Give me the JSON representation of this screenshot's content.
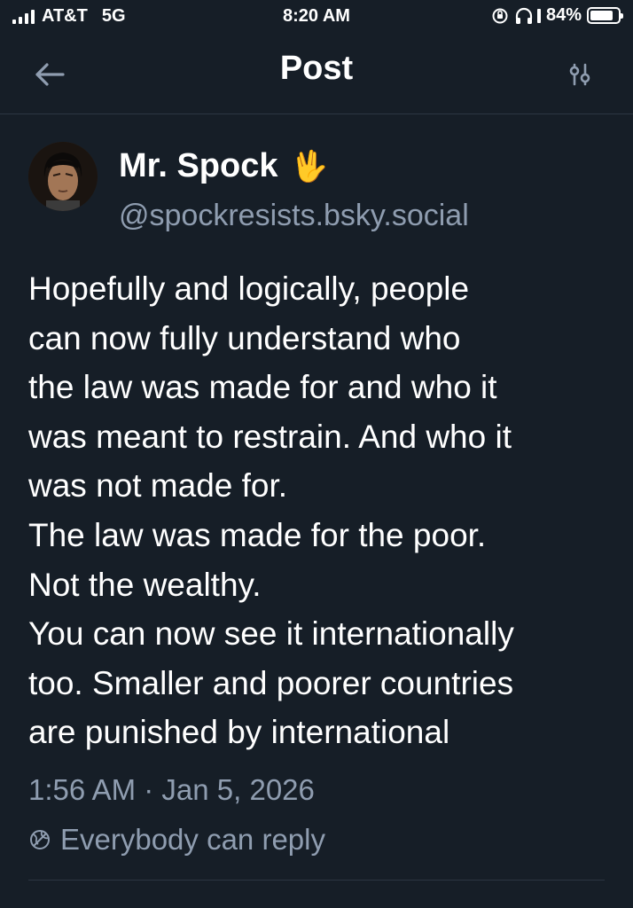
{
  "status_bar": {
    "carrier": "AT&T",
    "network": "5G",
    "time": "8:20 AM",
    "battery": "84%",
    "battery_level": 0.84
  },
  "header": {
    "title": "Post",
    "back_icon": "arrow-left-icon",
    "filter_icon": "sliders-icon"
  },
  "post": {
    "author": {
      "name": "Mr. Spock",
      "emoji": "🖖",
      "handle": "@spockresists.bsky.social"
    },
    "lines": [
      "Hopefully and logically, people",
      "can now fully understand who",
      "the law was made for and who it",
      "was meant to restrain. And who it",
      "was not made for.",
      "The law was made for the poor.",
      "Not the wealthy.",
      "You can now see it internationally",
      "too. Smaller and poorer countries",
      "are punished by international"
    ],
    "timestamp": "1:56 AM · Jan 5, 2026",
    "reply_setting": "Everybody can reply"
  },
  "colors": {
    "background": "#161e27",
    "secondary_text": "#8f9db0",
    "divider": "#2c3642"
  }
}
